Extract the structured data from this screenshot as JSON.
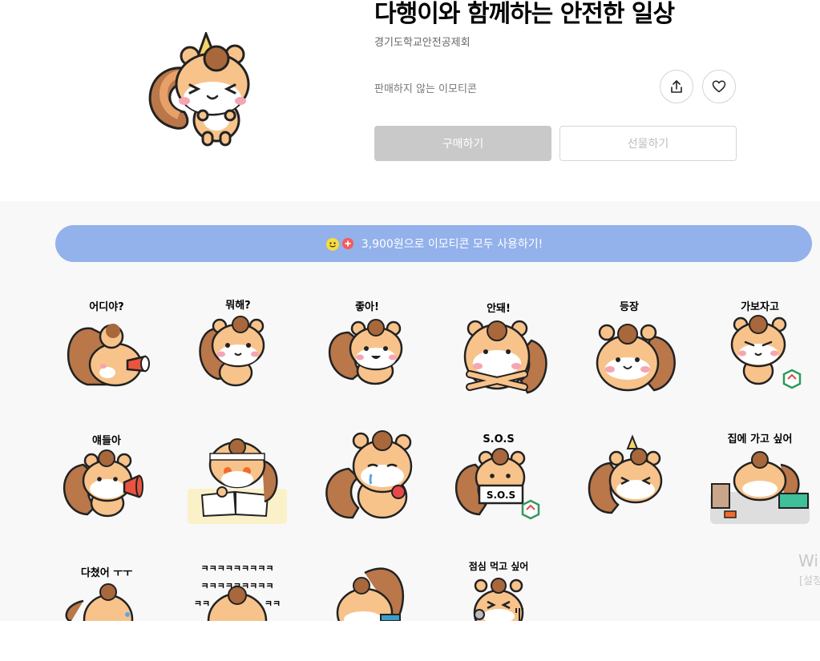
{
  "product": {
    "title": "다행이와 함께하는 안전한 일상",
    "author": "경기도학교안전공제회",
    "status": "판매하지 않는 이모티콘"
  },
  "actions": {
    "buy_label": "구매하기",
    "gift_label": "선물하기",
    "share_icon": "share-icon",
    "like_icon": "heart-icon"
  },
  "plus_banner": {
    "label": "3,900원으로 이모티콘 모두 사용하기!",
    "color": "#93b1eb"
  },
  "emoticons": [
    {
      "caption": "어디야?",
      "pose": "binoculars"
    },
    {
      "caption": "뭐해?",
      "pose": "curious"
    },
    {
      "caption": "좋아!",
      "pose": "happy"
    },
    {
      "caption": "안돼!",
      "pose": "cross-arms"
    },
    {
      "caption": "등장",
      "pose": "appear"
    },
    {
      "caption": "가보자고",
      "pose": "determined"
    },
    {
      "caption": "얘들아",
      "pose": "megaphone"
    },
    {
      "caption": "",
      "pose": "studying"
    },
    {
      "caption": "",
      "pose": "crying-apple"
    },
    {
      "caption": "S.O.S",
      "pose": "sos-sign",
      "sign_text": "S.O.S"
    },
    {
      "caption": "",
      "pose": "party-hat"
    },
    {
      "caption": "집에 가고 싶어",
      "pose": "tired-desk"
    },
    {
      "caption": "다쳤어 ㅜㅜ",
      "pose": "hurt"
    },
    {
      "caption": "ㅋㅋㅋㅋㅋㅋㅋㅋㅋ",
      "caption2": "ㅋㅋㅋㅋㅋㅋㅋㅋㅋ",
      "caption3": "ㅋㅋ",
      "caption4": "ㅋㅋ",
      "pose": "laughing"
    },
    {
      "caption": "",
      "pose": "eating"
    },
    {
      "caption": "점심 먹고 싶어",
      "pose": "hungry"
    }
  ],
  "watermark": {
    "line1": "Wi",
    "line2": "[설정"
  }
}
